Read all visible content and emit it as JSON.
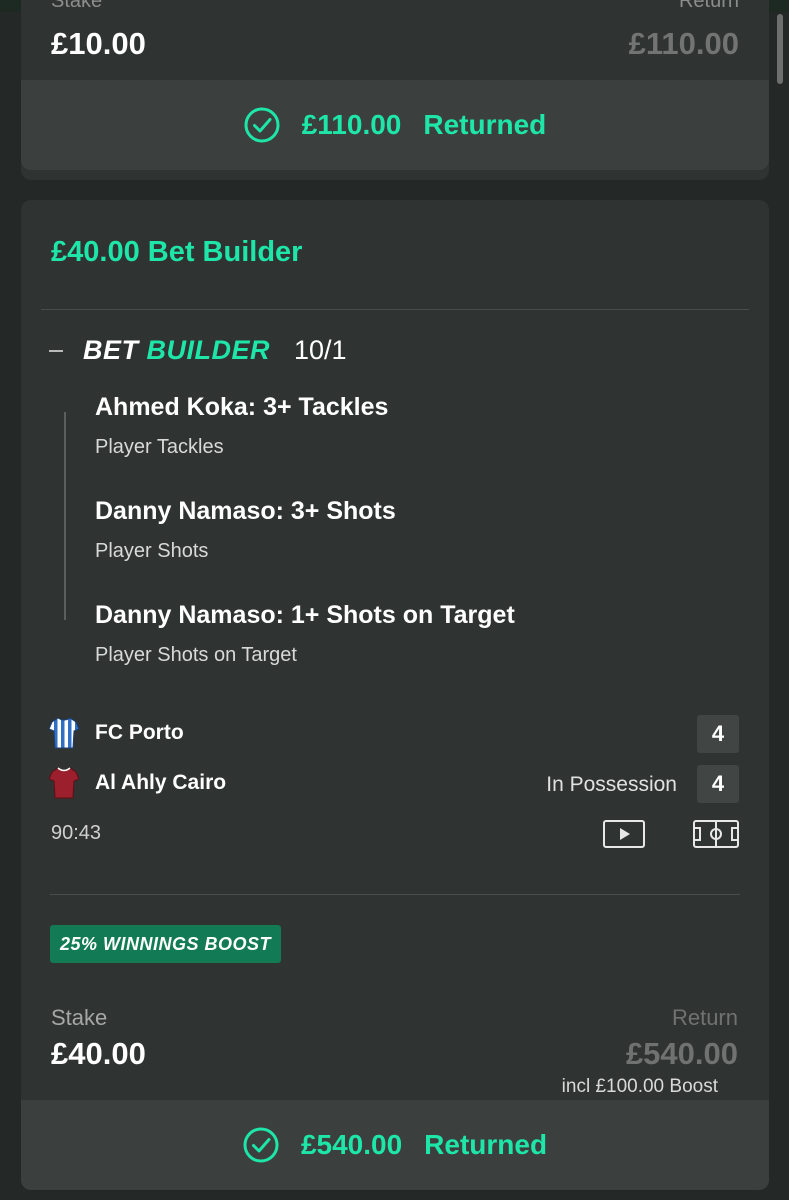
{
  "colors": {
    "accent": "#1ee6a8",
    "background": "#242826",
    "card": "#2f3331",
    "returned_band": "#3b3f3d",
    "boost_badge": "#127a55",
    "muted_text": "#6f7270"
  },
  "prev_bet": {
    "stake_label": "Stake",
    "return_label": "Return",
    "stake_value": "£10.00",
    "return_value": "£110.00",
    "returned_icon": "check-circle-icon",
    "returned_amount": "£110.00",
    "returned_label": "Returned"
  },
  "bet": {
    "title": "£40.00 Bet Builder",
    "collapse_icon": "minus-icon",
    "logo_part1": "BET",
    "logo_part2": "BUILDER",
    "odds": "10/1",
    "legs": [
      {
        "title": "Ahmed Koka: 3+ Tackles",
        "market": "Player Tackles"
      },
      {
        "title": "Danny Namaso: 3+ Shots",
        "market": "Player Shots"
      },
      {
        "title": "Danny Namaso: 1+ Shots on Target",
        "market": "Player Shots on Target"
      }
    ],
    "match": {
      "home": {
        "name": "FC Porto",
        "score": "4",
        "kit_icon": "porto-kit-icon"
      },
      "away": {
        "name": "Al Ahly Cairo",
        "score": "4",
        "kit_icon": "al-ahly-kit-icon"
      },
      "possession": "In Possession",
      "clock": "90:43",
      "video_icon": "play-video-icon",
      "pitch_icon": "pitch-tracker-icon"
    },
    "boost_badge": "25% WINNINGS BOOST",
    "stake_label": "Stake",
    "stake_value": "£40.00",
    "return_label": "Return",
    "return_value": "£540.00",
    "boost_note": "incl £100.00 Boost",
    "returned_icon": "check-circle-icon",
    "returned_amount": "£540.00",
    "returned_label": "Returned"
  }
}
